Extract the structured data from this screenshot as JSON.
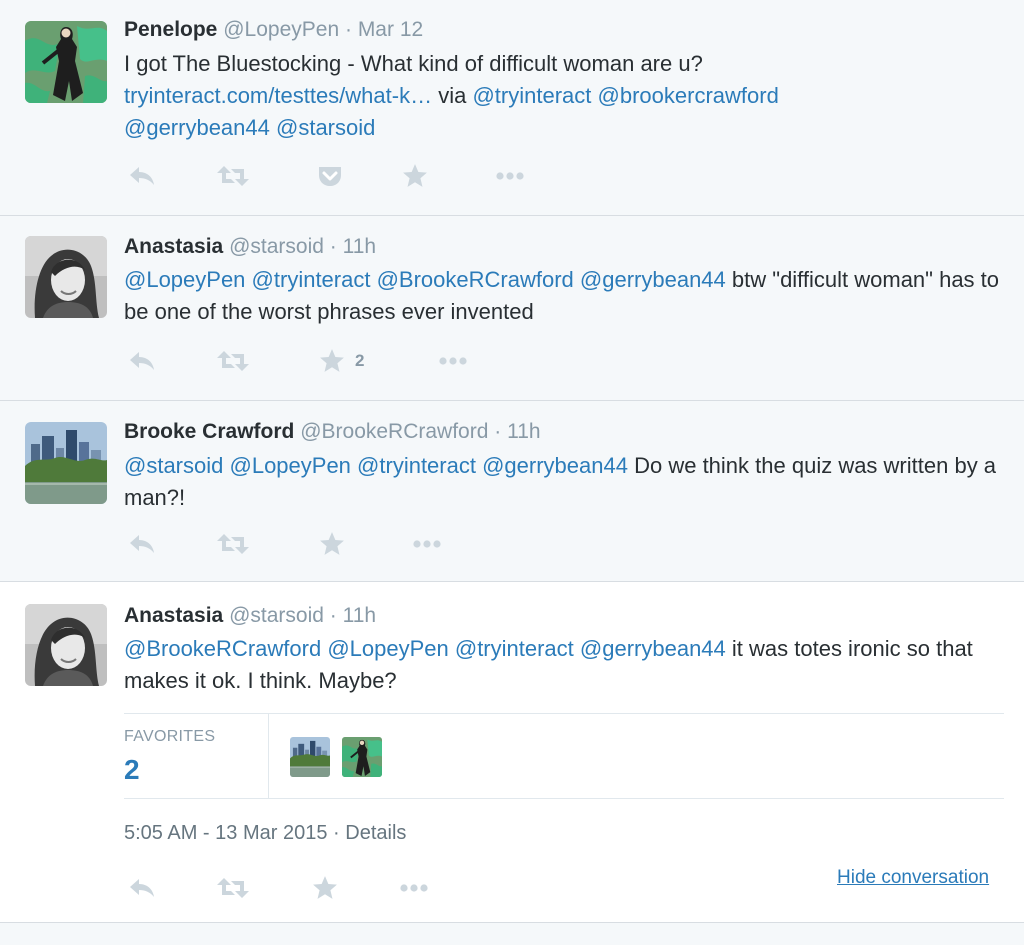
{
  "colors": {
    "link": "#2b7bb9",
    "muted": "#8899a6",
    "icon": "#ccd6dd",
    "text": "#292f33"
  },
  "tweets": [
    {
      "name": "Penelope",
      "handle": "@LopeyPen",
      "sep": "·",
      "time": "Mar 12",
      "text_plain": "I got The Bluestocking - What kind of difficult woman are u?",
      "link_url": "tryinteract.com/testtes/what-k…",
      "via": "via",
      "mentions": [
        "@tryinteract",
        "@brookercrawford",
        "@gerrybean44",
        "@starsoid"
      ],
      "avatar_icon": "avatar-penelope-illustration"
    },
    {
      "name": "Anastasia",
      "handle": "@starsoid",
      "sep": "·",
      "time": "11h",
      "mentions": [
        "@LopeyPen",
        "@tryinteract",
        "@BrookeRCrawford",
        "@gerrybean44"
      ],
      "text_plain": "btw \"difficult woman\" has to be one of the worst phrases ever invented",
      "favorite_count": "2",
      "avatar_icon": "avatar-anastasia-photo"
    },
    {
      "name": "Brooke Crawford",
      "handle": "@BrookeRCrawford",
      "sep": "·",
      "time": "11h",
      "mentions": [
        "@starsoid",
        "@LopeyPen",
        "@tryinteract",
        "@gerrybean44"
      ],
      "text_plain": "Do we think the quiz was written by a man?!",
      "avatar_icon": "avatar-brooke-cityscape"
    },
    {
      "name": "Anastasia",
      "handle": "@starsoid",
      "sep": "·",
      "time": "11h",
      "mentions": [
        "@BrookeRCrawford",
        "@LopeyPen",
        "@tryinteract",
        "@gerrybean44"
      ],
      "text_plain": "it was totes ironic so that makes it ok. I think. Maybe?",
      "avatar_icon": "avatar-anastasia-photo"
    }
  ],
  "focus": {
    "favorites_label": "FAVORITES",
    "favorites_count": "2",
    "timestamp": "5:05 AM - 13 Mar 2015",
    "meta_sep": "·",
    "details_label": "Details",
    "hide_conversation_label": "Hide conversation"
  },
  "icons": [
    "reply-icon",
    "retweet-icon",
    "pocket-icon",
    "favorite-icon",
    "more-icon"
  ]
}
